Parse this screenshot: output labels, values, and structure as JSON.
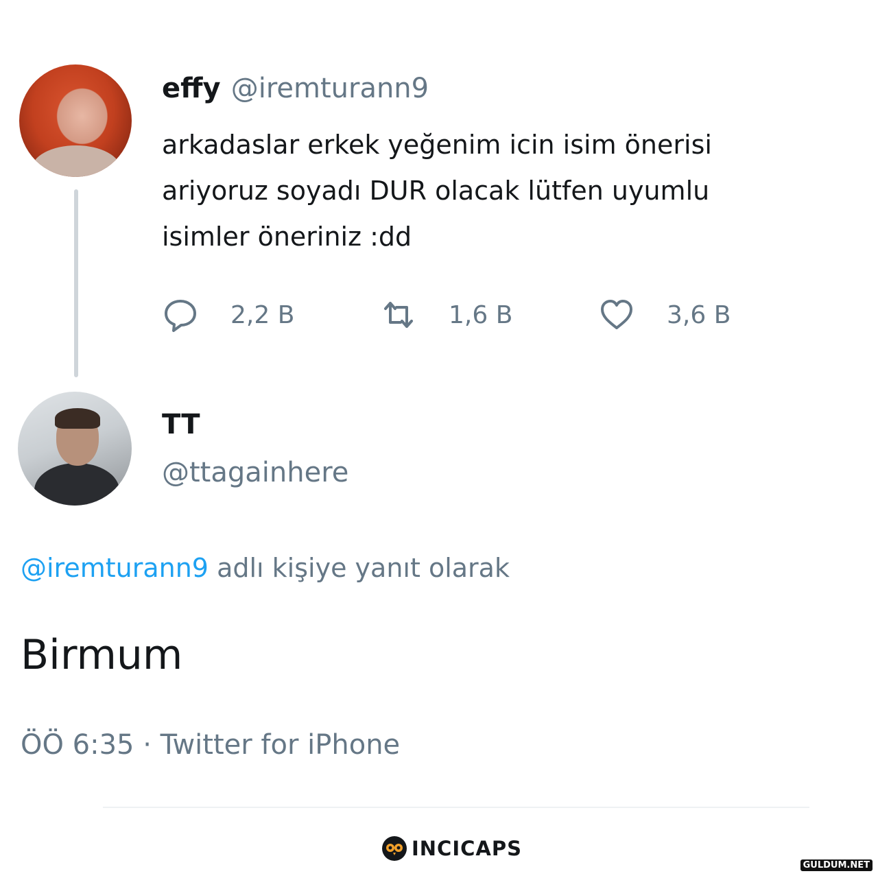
{
  "original_tweet": {
    "display_name": "effy",
    "handle": "@iremturann9",
    "text_lines": [
      "arkadaslar erkek yeğenim icin isim önerisi",
      "ariyoruz soyadı DUR olacak lütfen uyumlu",
      "isimler öneriniz :dd"
    ],
    "actions": {
      "replies": "2,2 B",
      "retweets": "1,6 B",
      "likes": "3,6 B"
    }
  },
  "reply_tweet": {
    "display_name": "TT",
    "handle": "@ttagainhere",
    "replying_to": {
      "mention": "@iremturann9",
      "suffix": "adlı kişiye yanıt olarak"
    },
    "text": "Birmum",
    "meta": "ÖÖ 6:35 · Twitter for iPhone"
  },
  "branding": {
    "name": "INCICAPS",
    "watermark": "GULDUM.NET"
  },
  "icons": [
    "reply-icon",
    "retweet-icon",
    "like-icon",
    "owl-logo-icon"
  ],
  "colors": {
    "text": "#14171a",
    "secondary": "#657786",
    "link": "#1da1f2",
    "thread_line": "#cfd5da"
  }
}
